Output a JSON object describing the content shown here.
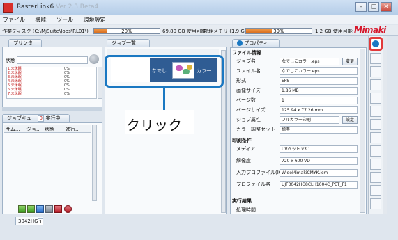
{
  "window": {
    "app_name": "RasterLink6",
    "version_text": "Ver 2.3 Beta4",
    "min_icon": "minimize-icon",
    "max_icon": "maximize-icon",
    "close_icon": "close-icon"
  },
  "menu": [
    "ファイル",
    "機能",
    "ツール",
    "環境設定"
  ],
  "status": {
    "work_disk_label": "作業ディスク (C:\\MjSuite\\Jobs\\RL01\\)",
    "work_disk_percent": 20,
    "work_disk_text": "20%",
    "work_disk_free": "69.80 GB 使用可能",
    "memory_label": "物理メモリ (1.9 GB)",
    "memory_percent": 39,
    "memory_text": "39%",
    "memory_free": "1.2 GB 使用可能",
    "logo": "Mimaki"
  },
  "printer_panel": {
    "tab": "プリンタ",
    "state_label": "状態",
    "queue_rows": [
      {
        "name": "1.未休眠",
        "pct": "0%"
      },
      {
        "name": "2.未休眠",
        "pct": "0%"
      },
      {
        "name": "3.未休眠",
        "pct": "0%"
      },
      {
        "name": "4.未休眠",
        "pct": "0%"
      },
      {
        "name": "5.未休眠",
        "pct": "0%"
      },
      {
        "name": "6.未休眠",
        "pct": "0%"
      },
      {
        "name": "7.未休眠",
        "pct": "0%"
      }
    ]
  },
  "job_queue_panel": {
    "tab": "ジョブキュー",
    "count": "0",
    "running_tab": "実行中",
    "columns": [
      "サム...",
      "ジョ...",
      "状態",
      "進行..."
    ]
  },
  "job_list_panel": {
    "tab": "ジョブ一覧",
    "job": {
      "left_label": "なでし...",
      "right_label": "カラー"
    }
  },
  "callout": {
    "text": "クリック"
  },
  "properties_panel": {
    "tab": "プロパティ",
    "section_file": "ファイル情報",
    "rows": [
      {
        "label": "ジョブ名",
        "value": "なでしこカラー.eps",
        "button": "変更"
      },
      {
        "label": "ファイル名",
        "value": "なでしこカラー.eps"
      },
      {
        "label": "形式",
        "value": "EPS"
      },
      {
        "label": "画像サイズ",
        "value": "1.86 MB"
      },
      {
        "label": "ページ数",
        "value": "1"
      },
      {
        "label": "ページサイズ",
        "value": "125.94 x 77.26 mm"
      },
      {
        "label": "ジョブ属性",
        "value": "フルカラー印刷",
        "button": "設定"
      },
      {
        "label": "カラー調整セット",
        "value": "標準"
      }
    ],
    "section_print": "印刷条件",
    "print_rows": [
      {
        "label": "メディア",
        "value": "UVペット v3.1"
      },
      {
        "label": "解像度",
        "value": "720 x 600 VD"
      },
      {
        "label": "入力プロファイル(ICC)",
        "value": "WideMimakiCMYK.icm"
      },
      {
        "label": "プロファイル名",
        "value": "UJF3042HG8CLH1004C_PET_F1"
      }
    ],
    "section_result": "実行結果",
    "result_rows": [
      {
        "label": "処理時間"
      }
    ]
  },
  "bottom": {
    "printer_tab": "3042HG",
    "printer_tab_num": "1"
  },
  "colors": {
    "accent_blue": "#1a78c2",
    "progress_orange": "#e57f2a",
    "job_tile_blue": "#2f5c93",
    "queue_red": "#c02020"
  }
}
